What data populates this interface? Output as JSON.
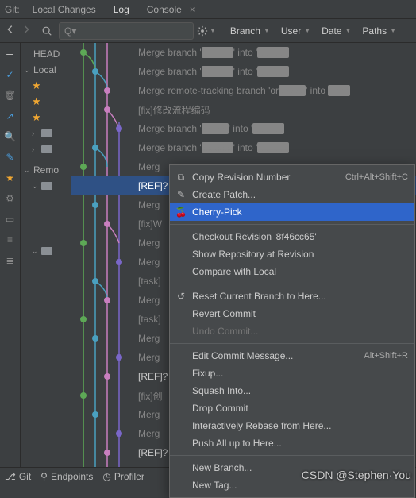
{
  "top": {
    "git_label": "Git:",
    "tabs": [
      "Local Changes",
      "Log",
      "Console"
    ],
    "active": 1
  },
  "filters": {
    "branch": "Branch",
    "user": "User",
    "date": "Date",
    "paths": "Paths"
  },
  "tree": {
    "head": "HEAD",
    "local": "Local",
    "remote": "Remo"
  },
  "commits": [
    {
      "msg_a": "Merge branch '",
      "blur1": "xxxxxx",
      "msg_b": "' into '",
      "blur2": "xxxxxx",
      "msg_c": ""
    },
    {
      "msg_a": "Merge branch '",
      "blur1": "xxxxxx",
      "msg_b": "' into '",
      "blur2": "xxxxxx",
      "msg_c": ""
    },
    {
      "msg_a": "Merge remote-tracking branch 'or",
      "blur1": "xxxxx",
      "msg_b": "' into ",
      "blur2": "xxxx",
      "msg_c": ""
    },
    {
      "msg_a": "[fix]修改流程编码"
    },
    {
      "msg_a": "Merge branch '",
      "blur1": "xxxxx",
      "msg_b": "' into '",
      "blur2": "xxxxxx",
      "msg_c": ""
    },
    {
      "msg_a": "Merge branch '",
      "blur1": "xxxxxx",
      "msg_b": "' into '",
      "blur2": "xxxxxx",
      "msg_c": ""
    },
    {
      "msg_a": "Merg"
    },
    {
      "ref": "[REF]?",
      "sel": true
    },
    {
      "msg_a": "Merg"
    },
    {
      "msg_a": "[fix]W"
    },
    {
      "msg_a": "Merg"
    },
    {
      "msg_a": "Merg"
    },
    {
      "msg_a": "[task]"
    },
    {
      "msg_a": "Merg"
    },
    {
      "msg_a": "[task]"
    },
    {
      "msg_a": "Merg"
    },
    {
      "msg_a": "Merg"
    },
    {
      "ref": "[REF]?"
    },
    {
      "msg_a": "[fix]创"
    },
    {
      "msg_a": "Merg"
    },
    {
      "msg_a": "Merg"
    },
    {
      "ref": "[REF]?"
    }
  ],
  "ctx": {
    "copy": "Copy Revision Number",
    "copy_sc": "Ctrl+Alt+Shift+C",
    "patch": "Create Patch...",
    "cherry": "Cherry-Pick",
    "checkout": "Checkout Revision '8f46cc65'",
    "showrepo": "Show Repository at Revision",
    "compare": "Compare with Local",
    "reset": "Reset Current Branch to Here...",
    "revert": "Revert Commit",
    "undo": "Undo Commit...",
    "edit": "Edit Commit Message...",
    "edit_sc": "Alt+Shift+R",
    "fixup": "Fixup...",
    "squash": "Squash Into...",
    "drop": "Drop Commit",
    "rebase": "Interactively Rebase from Here...",
    "pushall": "Push All up to Here...",
    "newbranch": "New Branch...",
    "newtag": "New Tag..."
  },
  "bottom": {
    "git": "Git",
    "endpoints": "Endpoints",
    "profiler": "Profiler"
  },
  "watermark": "CSDN @Stephen·You"
}
